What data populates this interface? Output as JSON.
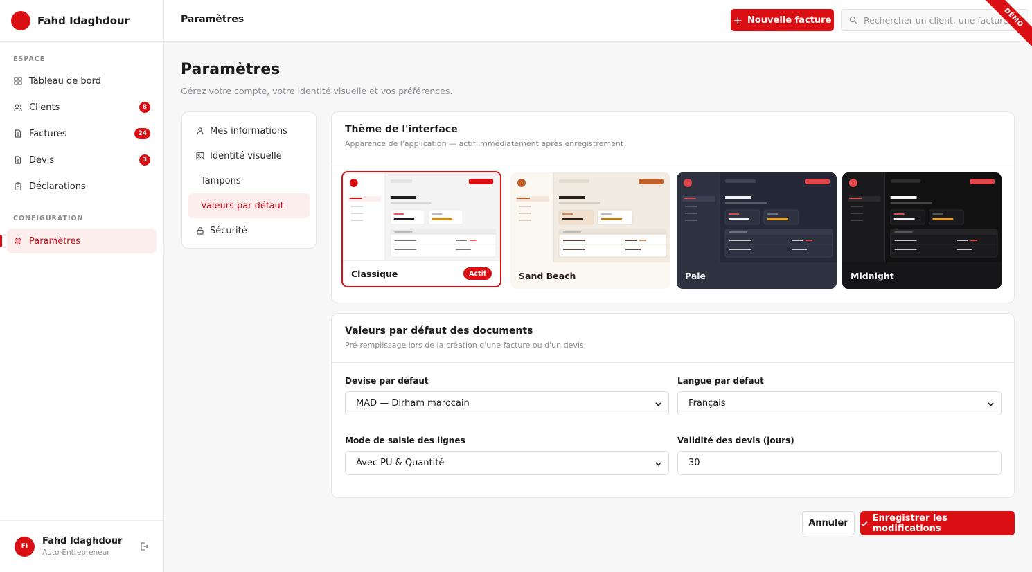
{
  "brand": {
    "name": "Fahd Idaghdour"
  },
  "sidebar": {
    "section_espace": "ESPACE",
    "section_config": "CONFIGURATION",
    "items": [
      {
        "label": "Tableau de bord",
        "icon": "grid-icon",
        "badge": ""
      },
      {
        "label": "Clients",
        "icon": "users-icon",
        "badge": "8"
      },
      {
        "label": "Factures",
        "icon": "document-icon",
        "badge": "24"
      },
      {
        "label": "Devis",
        "icon": "document-icon",
        "badge": "3"
      },
      {
        "label": "Déclarations",
        "icon": "clipboard-icon",
        "badge": ""
      },
      {
        "label": "Paramètres",
        "icon": "gear-icon",
        "badge": ""
      }
    ],
    "user": {
      "initials": "FI",
      "name": "Fahd Idaghdour",
      "role": "Auto-Entrepreneur"
    }
  },
  "topbar": {
    "title": "Paramètres",
    "new_invoice": "Nouvelle facture",
    "search_placeholder": "Rechercher un client, une facture...",
    "demo": "DÉMO"
  },
  "page": {
    "title": "Paramètres",
    "subtitle": "Gérez votre compte, votre identité visuelle et vos préférences."
  },
  "subnav": [
    {
      "label": "Mes informations",
      "icon": "user-icon"
    },
    {
      "label": "Identité visuelle",
      "icon": "image-icon"
    },
    {
      "label": "Tampons",
      "icon": ""
    },
    {
      "label": "Valeurs par défaut",
      "icon": ""
    },
    {
      "label": "Sécurité",
      "icon": "lock-icon"
    }
  ],
  "theme_card": {
    "title": "Thème de l'interface",
    "subtitle": "Apparence de l'application — actif immédiatement après enregistrement",
    "themes": [
      {
        "name": "Classique",
        "active": true
      },
      {
        "name": "Sand Beach",
        "active": false
      },
      {
        "name": "Pale",
        "active": false
      },
      {
        "name": "Midnight",
        "active": false
      }
    ],
    "active_label": "Actif"
  },
  "defaults_card": {
    "title": "Valeurs par défaut des documents",
    "subtitle": "Pré-remplissage lors de la création d'une facture ou d'un devis",
    "currency_label": "Devise par défaut",
    "currency_value": "MAD — Dirham marocain",
    "language_label": "Langue par défaut",
    "language_value": "Français",
    "mode_label": "Mode de saisie des lignes",
    "mode_value": "Avec PU & Quantité",
    "validity_label": "Validité des devis (jours)",
    "validity_value": "30"
  },
  "actions": {
    "cancel": "Annuler",
    "save": "Enregistrer les modifications"
  },
  "colors": {
    "accent": "#d90f14",
    "active_bg": "#fdeeee"
  }
}
